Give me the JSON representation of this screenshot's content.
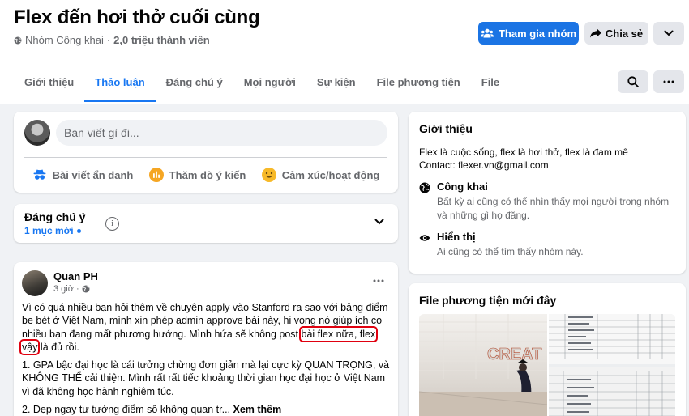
{
  "group": {
    "title": "Flex đến hơi thở cuối cùng",
    "privacy": "Nhóm Công khai",
    "members": "2,0 triệu thành viên",
    "join_label": "Tham gia nhóm",
    "share_label": "Chia sẻ"
  },
  "tabs": [
    "Giới thiệu",
    "Thảo luận",
    "Đáng chú ý",
    "Mọi người",
    "Sự kiện",
    "File phương tiện",
    "File"
  ],
  "active_tab": "Thảo luận",
  "composer": {
    "placeholder": "Bạn viết gì đi...",
    "actions": [
      "Bài viết ẩn danh",
      "Thăm dò ý kiến",
      "Cảm xúc/hoạt động"
    ]
  },
  "featured": {
    "title": "Đáng chú ý",
    "sub": "1 mục mới"
  },
  "post": {
    "author": "Quan PH",
    "time": "3 giờ",
    "para1_before": "Vì có quá nhiều bạn hỏi thêm về chuyện apply vào Stanford ra sao với bảng điểm be bét ở Việt Nam, mình xin phép admin approve bài này, hi vọng nó giúp ích co nhiều bạn đang mất phương hướng. Mình hứa sẽ không post ",
    "para1_highlight": "bài flex nữa, flex vậy",
    "para1_after": " là đủ rồi.",
    "para2": "1. GPA bậc đại học là cái tưởng chừng đơn giản mà lại cực kỳ QUAN TRỌNG, và KHÔNG THỂ cải thiện. Mình rất rất tiếc khoảng thời gian học đại học ở Việt Nam vì đã không học hành nghiêm túc.",
    "para3": "2. Dẹp ngay tư tưởng điểm số không quan tr... ",
    "see_more": "Xem thêm"
  },
  "about": {
    "heading": "Giới thiệu",
    "line1": "Flex là cuộc sống, flex là hơi thở, flex là đam mê",
    "line2": "Contact: flexer.vn@gmail.com",
    "public_title": "Công khai",
    "public_desc": "Bất kỳ ai cũng có thể nhìn thấy mọi người trong nhóm và những gì họ đăng.",
    "visible_title": "Hiển thị",
    "visible_desc": "Ai cũng có thể tìm thấy nhóm này."
  },
  "media": {
    "heading": "File phương tiện mới đây",
    "img1_text": "CREAT"
  },
  "colors": {
    "accent": "#1877f2",
    "join_button": "#1b74e4",
    "highlight_box": "#e0000f"
  },
  "icons": [
    "globe-icon",
    "join-group-icon",
    "share-arrow-icon",
    "chevron-down-icon",
    "search-icon",
    "more-dots-icon",
    "anonymous-icon",
    "poll-icon",
    "emoji-icon",
    "info-icon",
    "public-globe-icon",
    "eye-icon"
  ]
}
